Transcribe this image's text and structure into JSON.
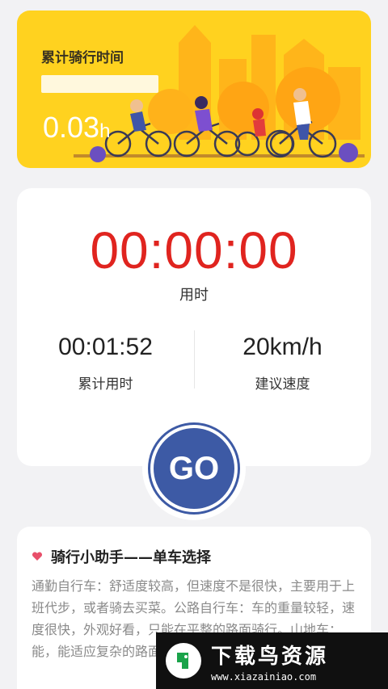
{
  "banner": {
    "title": "累计骑行时间",
    "subtitle": "",
    "value": "0.03",
    "unit": "h",
    "background": "#ffd21f"
  },
  "timer": {
    "main": "00:00:00",
    "main_label": "用时",
    "cumulative_value": "00:01:52",
    "cumulative_label": "累计用时",
    "speed_value": "20km/h",
    "speed_label": "建议速度",
    "accent": "#e0241f"
  },
  "go_button": {
    "label": "GO",
    "color": "#3d5aa5"
  },
  "tips": {
    "icon": "heart-icon",
    "title": "骑行小助手——单车选择",
    "body": "通勤自行车：舒适度较高，但速度不是很快，主要用于上班代步，或者骑去买菜。公路自行车：车的重量较轻，速度很快，外观好看，只能在平整的路面骑行。山地车：能，能适应复杂的路面"
  },
  "watermark": {
    "title": "下载鸟资源",
    "url": "www.xiazainiao.com"
  }
}
